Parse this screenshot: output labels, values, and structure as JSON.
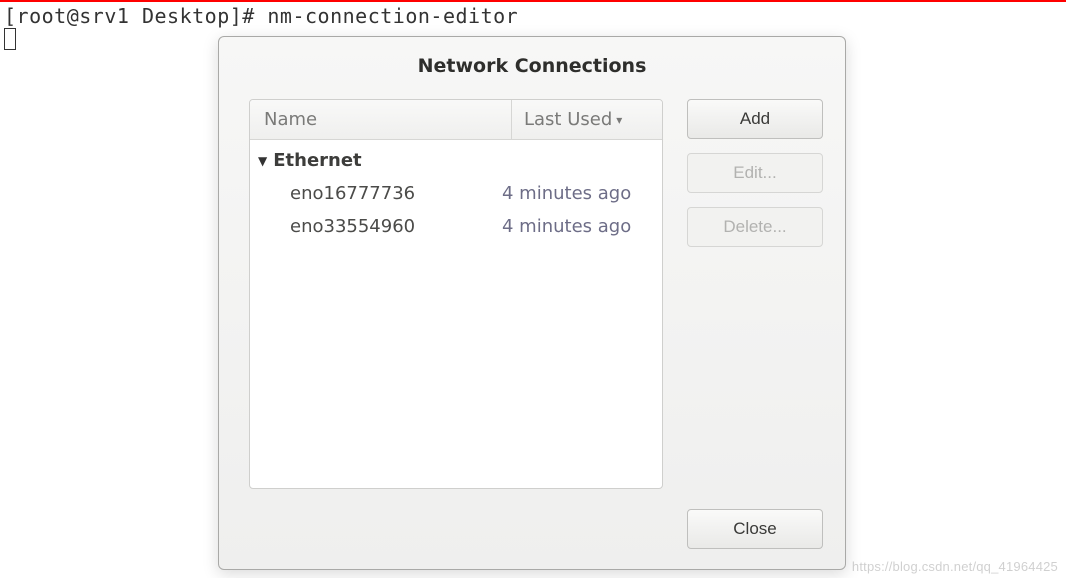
{
  "terminal": {
    "prompt": "[root@srv1 Desktop]# ",
    "command": "nm-connection-editor"
  },
  "dialog": {
    "title": "Network Connections",
    "columns": {
      "name": "Name",
      "last_used": "Last Used"
    },
    "group": "Ethernet",
    "connections": [
      {
        "name": "eno16777736",
        "last_used": "4 minutes ago"
      },
      {
        "name": "eno33554960",
        "last_used": "4 minutes ago"
      }
    ],
    "buttons": {
      "add": "Add",
      "edit": "Edit...",
      "delete": "Delete...",
      "close": "Close"
    }
  },
  "watermark": "https://blog.csdn.net/qq_41964425"
}
